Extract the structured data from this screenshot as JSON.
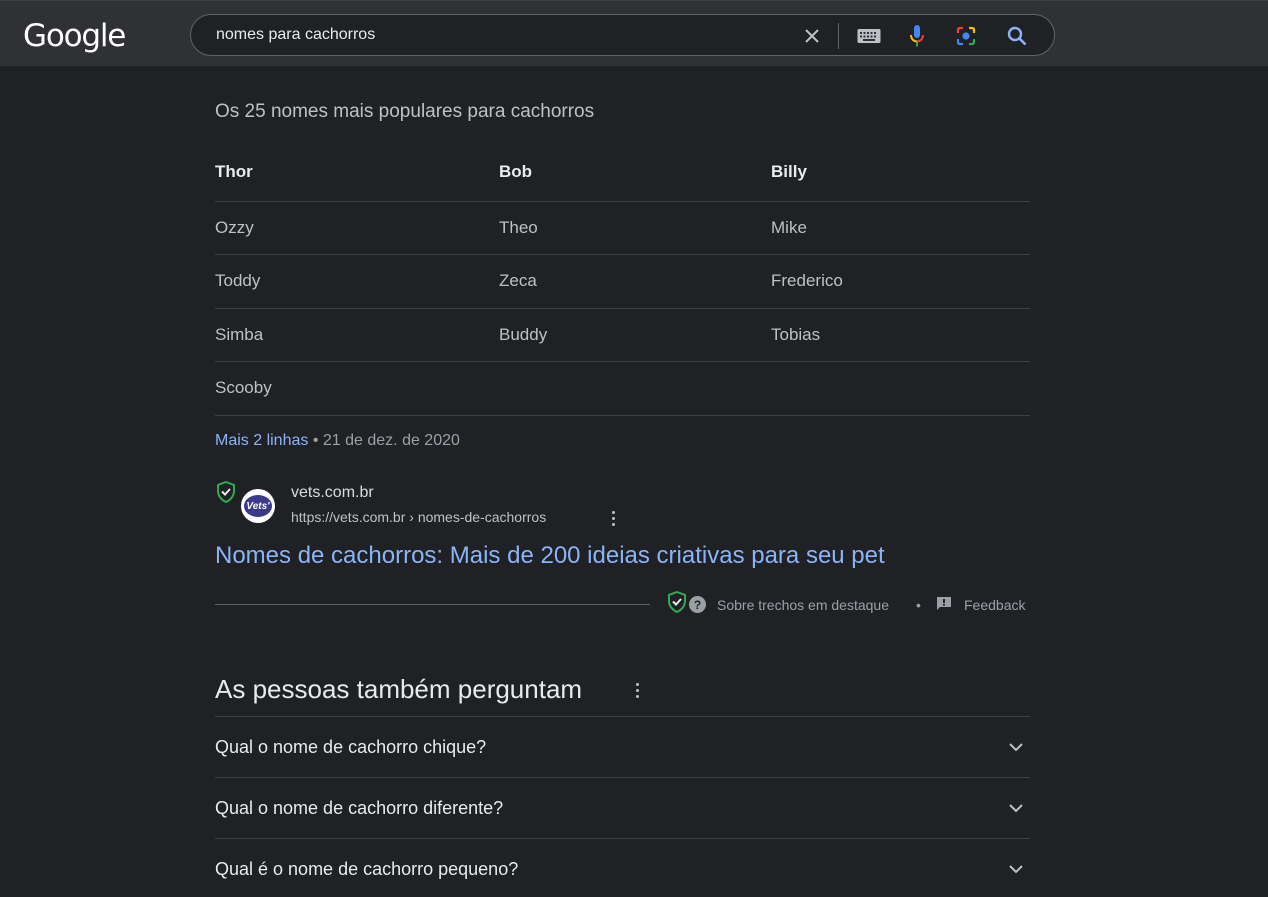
{
  "header": {
    "logo": "Google",
    "search": {
      "value": "nomes para cachorros",
      "icons": [
        "close-icon",
        "keyboard-icon",
        "microphone-icon",
        "lens-camera-icon",
        "search-icon"
      ]
    }
  },
  "snippet": {
    "title": "Os 25 nomes mais populares para cachorros",
    "header_row": [
      "Thor",
      "Bob",
      "Billy"
    ],
    "rows": [
      [
        "Ozzy",
        "Theo",
        "Mike"
      ],
      [
        "Toddy",
        "Zeca",
        "Frederico"
      ],
      [
        "Simba",
        "Buddy",
        "Tobias"
      ],
      [
        "Scooby",
        "",
        ""
      ]
    ],
    "more_link": "Mais 2 linhas",
    "separator": "•",
    "date": "21 de dez. de 2020"
  },
  "result": {
    "favicon_text": "Vets'",
    "site_name": "vets.com.br",
    "url": "https://vets.com.br › nomes-de-cachorros",
    "title": "Nomes de cachorros: Mais de 200 ideias criativas para seu pet"
  },
  "footer": {
    "help_glyph": "?",
    "about": "Sobre trechos em destaque",
    "separator": "•",
    "feedback": "Feedback"
  },
  "paa": {
    "title": "As pessoas também perguntam",
    "questions": [
      "Qual o nome de cachorro chique?",
      "Qual o nome de cachorro diferente?",
      "Qual é o nome de cachorro pequeno?"
    ]
  },
  "colors": {
    "background": "#202124",
    "header": "#303134",
    "link": "#8ab4f8",
    "text": "#bdc1c6",
    "shield_green": "#34a853"
  }
}
